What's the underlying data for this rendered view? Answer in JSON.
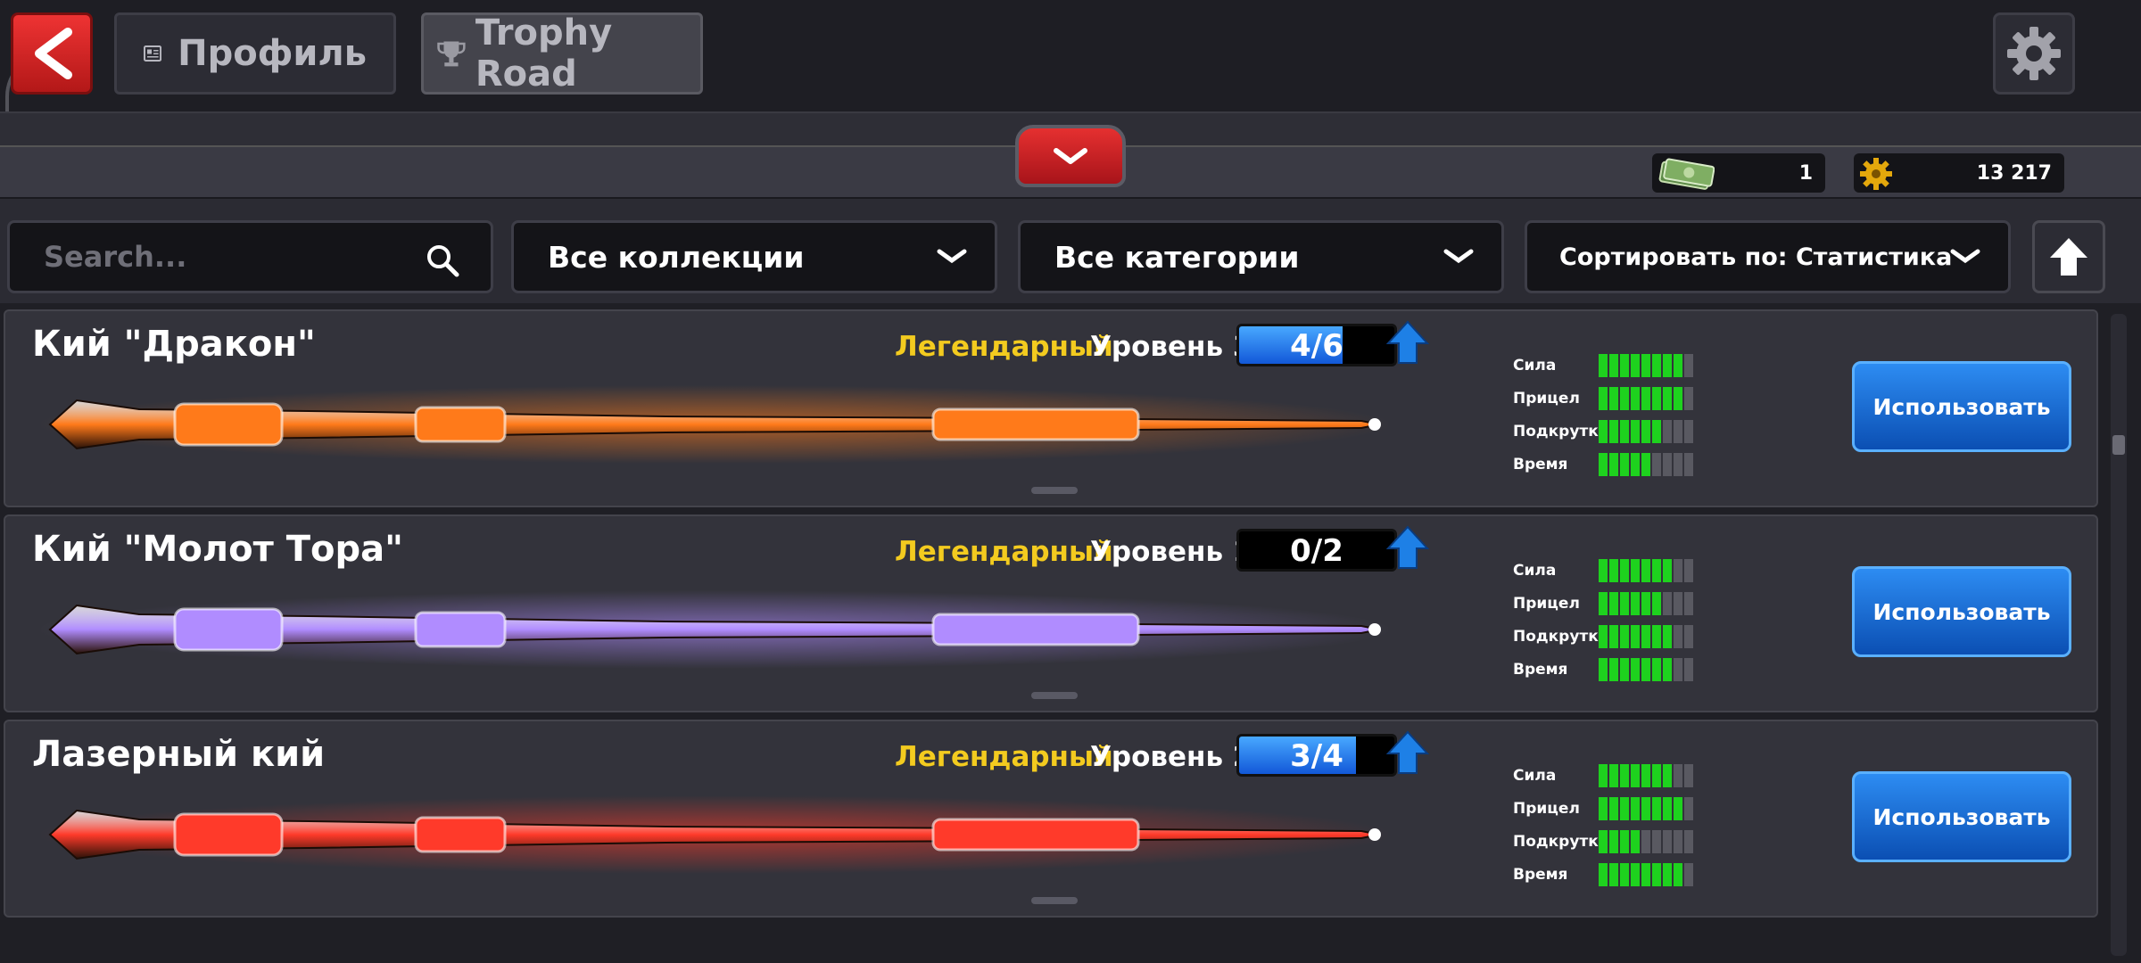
{
  "header": {
    "back_icon": "chevron-left-icon",
    "tabs": [
      {
        "label": "Профиль",
        "icon": "profile-card-icon"
      },
      {
        "label": "Trophy Road",
        "icon": "trophy-icon"
      }
    ],
    "settings_icon": "gear-icon"
  },
  "currencies": [
    {
      "name": "cash",
      "icon": "cash-icon",
      "value": "1"
    },
    {
      "name": "coins",
      "icon": "coin-icon",
      "value": "13 217"
    }
  ],
  "filters": {
    "search_placeholder": "Search...",
    "collections": "Все коллекции",
    "categories": "Все категории",
    "sort": "Сортировать по: Статистика"
  },
  "stat_labels": [
    "Сила",
    "Прицел",
    "Подкрутка",
    "Время"
  ],
  "cues": [
    {
      "name": "Кий \"Дракон\"",
      "rarity": "Легендарный",
      "level": "Уровень 3",
      "progress": "4/6",
      "progress_fraction": 0.667,
      "stats": [
        8,
        8,
        6,
        5
      ],
      "use_label": "Использовать",
      "accent": "#ff7a1a"
    },
    {
      "name": "Кий \"Молот Тора\"",
      "rarity": "Легендарный",
      "level": "Уровень 1",
      "progress": "0/2",
      "progress_fraction": 0,
      "stats": [
        7,
        6,
        7,
        7
      ],
      "use_label": "Использовать",
      "accent": "#b08cff"
    },
    {
      "name": "Лазерный кий",
      "rarity": "Легендарный",
      "level": "Уровень 2",
      "progress": "3/4",
      "progress_fraction": 0.75,
      "stats": [
        7,
        8,
        4,
        8
      ],
      "use_label": "Использовать",
      "accent": "#ff3a2a"
    }
  ],
  "max_stat": 9,
  "colors": {
    "rarity": "#f3cb1f",
    "stat_on": "#1ed21e",
    "use_button": "#1f74e0",
    "back_button": "#e33333"
  }
}
